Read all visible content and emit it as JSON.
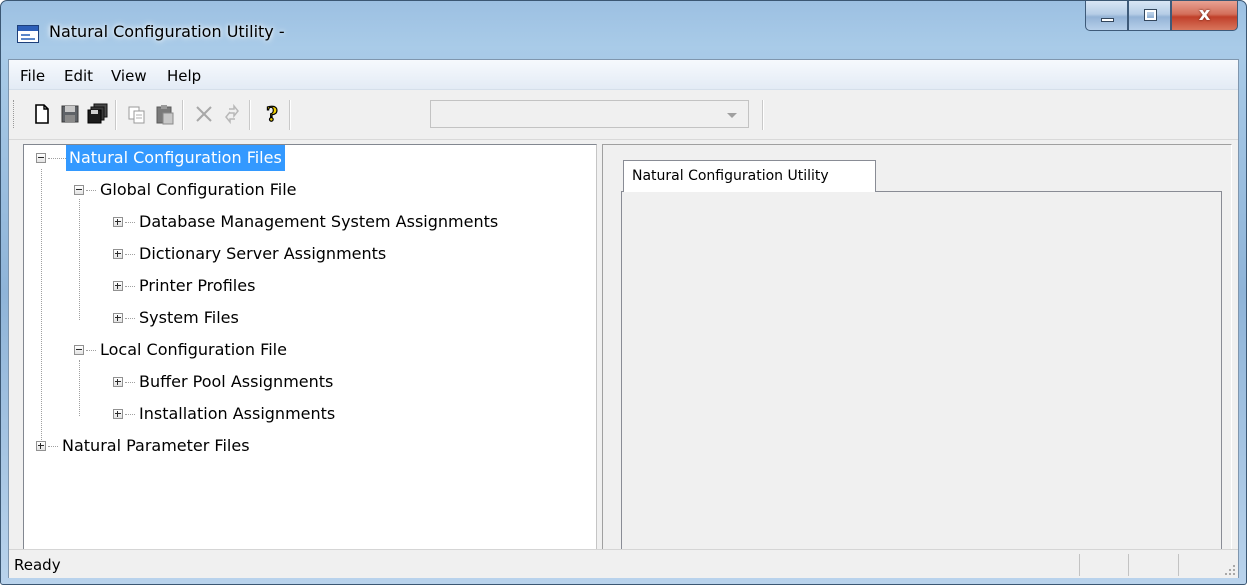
{
  "window": {
    "title": "Natural Configuration Utility -",
    "caption_buttons": [
      "minimize-icon",
      "maximize-icon",
      "close-icon"
    ],
    "close_glyph": "x"
  },
  "menu": {
    "items": [
      {
        "label": "File"
      },
      {
        "label": "Edit"
      },
      {
        "label": "View"
      },
      {
        "label": "Help"
      }
    ]
  },
  "toolbar": {
    "buttons": [
      "new-file-icon",
      "save-icon",
      "save-all-icon",
      "copy-icon",
      "paste-icon",
      "delete-icon",
      "refresh-icon",
      "help-icon"
    ],
    "help_glyph": "?",
    "combo": {
      "value": "",
      "enabled": false
    }
  },
  "tree": {
    "root": "Natural Configuration Files",
    "global": "Global Configuration File",
    "global_children": [
      {
        "label": "Database Management System Assignments"
      },
      {
        "label": "Dictionary Server Assignments"
      },
      {
        "label": "Printer Profiles"
      },
      {
        "label": "System Files"
      }
    ],
    "local": "Local Configuration File",
    "local_children": [
      {
        "label": "Buffer Pool Assignments"
      },
      {
        "label": "Installation Assignments"
      }
    ],
    "params": "Natural Parameter Files",
    "selected": "Natural Configuration Files"
  },
  "detail": {
    "tab_label": "Natural Configuration Utility"
  },
  "status": {
    "text": "Ready"
  },
  "colors": {
    "selection": "#3399ff",
    "close_button": "#c0402a",
    "frame": "#a9cbe8"
  }
}
